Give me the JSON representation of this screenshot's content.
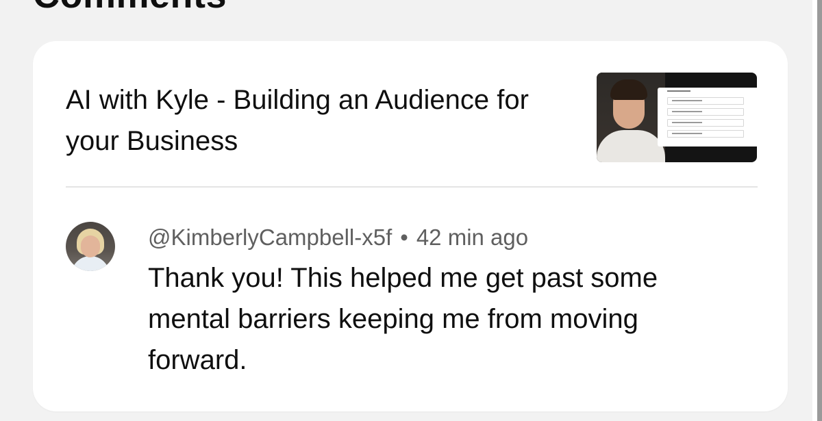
{
  "section": {
    "heading": "Comments"
  },
  "video": {
    "title": "AI with Kyle - Building an Audience for your Business",
    "thumbnail_icon": "video-thumbnail"
  },
  "comment": {
    "author": "@KimberlyCampbell-x5f",
    "separator": "•",
    "time": "42 min ago",
    "text": "Thank you! This helped me get past some mental barriers keeping me from moving forward.",
    "avatar_icon": "user-avatar"
  },
  "colors": {
    "page_background": "#f2f2f2",
    "card_background": "#ffffff",
    "primary_text": "#0f0f0f",
    "secondary_text": "#5f5f5f",
    "divider": "#e4e4e4"
  }
}
